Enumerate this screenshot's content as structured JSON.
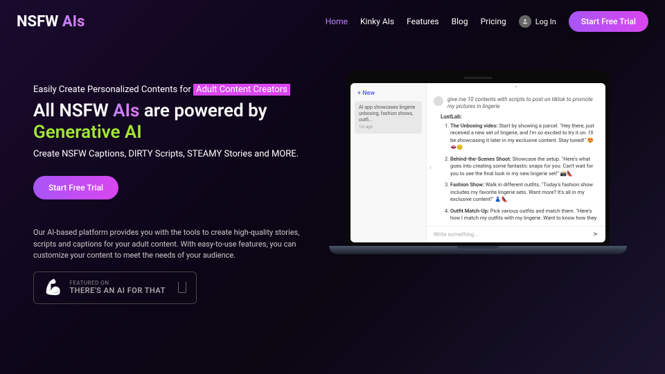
{
  "logo": {
    "part1": "NSFW ",
    "part2": "AIs"
  },
  "nav": {
    "home": "Home",
    "kinky": "Kinky AIs",
    "features": "Features",
    "blog": "Blog",
    "pricing": "Pricing",
    "login": "Log In",
    "cta": "Start Free Trial"
  },
  "hero": {
    "eyebrow_prefix": "Easily Create Personalized Contents for ",
    "eyebrow_highlight": "Adult Content Creators",
    "headline_p1": "All NSFW ",
    "headline_p2": "AIs",
    "headline_p3": " are powered by ",
    "headline_p4": "Generative AI",
    "subhead": "Create NSFW Captions, DIRTY Scripts, STEAMY Stories and MORE.",
    "cta": "Start Free Trial",
    "desc": "Our AI-based platform provides you with the tools to create high-quality stories, scripts and captions for your adult content. With easy-to-use features, you can customize your content to meet the needs of your audience.",
    "badge_small": "FEATURED ON",
    "badge_main": "THERE'S AN AI FOR THAT"
  },
  "app": {
    "new_btn": "New",
    "sidebar_item": "AI app showcases lingerie unboxing, fashion shows, outfi...",
    "sidebar_time": "1m ago",
    "user_msg": "give me 10 contents with scripts to post on tiktok to promote my pictures in lingerie",
    "bot_name": "LustLab:",
    "items": [
      {
        "title": "The Unboxing video:",
        "body": " Start by showing a parcel. \"Hey there, just received a new set of lingerie, and I'm so excited to try it on. I'll be showcasing it later in my exclusive content. Stay tuned!\" 😍👄😊"
      },
      {
        "title": "Behind-the-Scenes Shoot:",
        "body": " Showcase the setup. \"Here's what goes into creating some fantastic snaps for you. Can't wait for you to see the final look in my new lingerie set!\" 📸👠"
      },
      {
        "title": "Fashion Show:",
        "body": " Walk in different outfits. \"Today's fashion show includes my favorite lingerie sets. Want more? It's all in my exclusive content!\" 👗👠"
      },
      {
        "title": "Outfit Match-Up:",
        "body": " Pick various outfits and match them. \"Here's how I match my outfits with my lingerie. Want to know how they"
      }
    ],
    "composer_placeholder": "Write something..."
  }
}
